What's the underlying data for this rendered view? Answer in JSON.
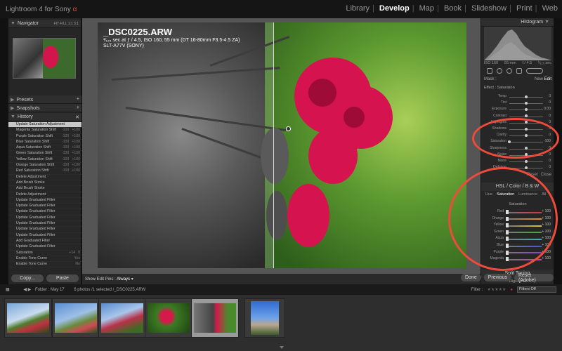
{
  "app": {
    "title": "Lightroom 4 for Sony",
    "brand_mark": "α"
  },
  "modules": [
    "Library",
    "Develop",
    "Map",
    "Book",
    "Slideshow",
    "Print",
    "Web"
  ],
  "active_module": "Develop",
  "left_panel": {
    "navigator": {
      "title": "Navigator",
      "zoom_options": [
        "FIT",
        "FILL",
        "1:1",
        "3:1"
      ]
    },
    "presets": {
      "title": "Presets"
    },
    "snapshots": {
      "title": "Snapshots"
    },
    "history": {
      "title": "History",
      "items": [
        {
          "label": "Update Saturation Adjustment",
          "v1": "",
          "v2": ""
        },
        {
          "label": "Magenta Saturation Shift",
          "v1": "-100",
          "v2": "+100"
        },
        {
          "label": "Purple Saturation Shift",
          "v1": "-100",
          "v2": "+100"
        },
        {
          "label": "Blue Saturation Shift",
          "v1": "-100",
          "v2": "+100"
        },
        {
          "label": "Aqua Saturation Shift",
          "v1": "-100",
          "v2": "+100"
        },
        {
          "label": "Green Saturation Shift",
          "v1": "-100",
          "v2": "+100"
        },
        {
          "label": "Yellow Saturation Shift",
          "v1": "-100",
          "v2": "+100"
        },
        {
          "label": "Orange Saturation Shift",
          "v1": "-100",
          "v2": "+100"
        },
        {
          "label": "Red Saturation Shift",
          "v1": "-100",
          "v2": "+100"
        },
        {
          "label": "Delete Adjustment",
          "v1": "",
          "v2": ""
        },
        {
          "label": "Add Brush Stroke",
          "v1": "",
          "v2": ""
        },
        {
          "label": "Add Brush Stroke",
          "v1": "",
          "v2": ""
        },
        {
          "label": "Delete Adjustment",
          "v1": "",
          "v2": ""
        },
        {
          "label": "Update Graduated Filter",
          "v1": "",
          "v2": ""
        },
        {
          "label": "Update Graduated Filter",
          "v1": "",
          "v2": ""
        },
        {
          "label": "Update Graduated Filter",
          "v1": "",
          "v2": ""
        },
        {
          "label": "Update Graduated Filter",
          "v1": "",
          "v2": ""
        },
        {
          "label": "Update Graduated Filter",
          "v1": "",
          "v2": ""
        },
        {
          "label": "Update Graduated Filter",
          "v1": "",
          "v2": ""
        },
        {
          "label": "Update Graduated Filter",
          "v1": "",
          "v2": ""
        },
        {
          "label": "Add Graduated Filter",
          "v1": "",
          "v2": ""
        },
        {
          "label": "Update Graduated Filter",
          "v1": "",
          "v2": ""
        },
        {
          "label": "Saturation",
          "v1": "+14",
          "v2": "0"
        },
        {
          "label": "Enable Tone Curve",
          "v1": "",
          "v2": "Yes"
        },
        {
          "label": "Enable Tone Curve",
          "v1": "",
          "v2": "No"
        }
      ]
    },
    "buttons": {
      "copy": "Copy...",
      "paste": "Paste"
    }
  },
  "photo": {
    "filename": "_DSC0225.ARW",
    "exposure": "¹⁄₁₂₅ sec at ƒ / 4.5, ISO 160, 55 mm (DT 16-80mm F3.5-4.5 ZA)",
    "camera": "SLT-A77V (SONY)"
  },
  "toolbar": {
    "show_edit_pins_label": "Show Edit Pins :",
    "show_edit_pins_value": "Always"
  },
  "right_panel": {
    "histogram": {
      "title": "Histogram",
      "readout": [
        "ISO 160",
        "55 mm",
        "f / 4.5",
        "¹⁄₁₂₅ sec"
      ]
    },
    "mask": {
      "label": "Mask :",
      "new": "New",
      "edit": "Edit"
    },
    "effect": {
      "label": "Effect :",
      "value": "Saturation"
    },
    "brush_sliders": [
      {
        "label": "Temp",
        "pos": 0.5,
        "value": "0"
      },
      {
        "label": "Tint",
        "pos": 0.5,
        "value": "0"
      },
      {
        "label": "Exposure",
        "pos": 0.5,
        "value": "0.00"
      },
      {
        "label": "Contrast",
        "pos": 0.5,
        "value": "0"
      },
      {
        "label": "Highlights",
        "pos": 0.5,
        "value": "0"
      },
      {
        "label": "Shadows",
        "pos": 0.5,
        "value": "0"
      },
      {
        "label": "Clarity",
        "pos": 0.5,
        "value": "0"
      },
      {
        "label": "Saturation",
        "pos": 0.0,
        "value": "-100"
      },
      {
        "label": "Sharpness",
        "pos": 0.5,
        "value": "0"
      },
      {
        "label": "Noise",
        "pos": 0.5,
        "value": "0"
      },
      {
        "label": "Moiré",
        "pos": 0.5,
        "value": "0"
      },
      {
        "label": "Defringe",
        "pos": 0.5,
        "value": "0"
      }
    ],
    "reset_close": {
      "reset": "Reset",
      "close": "Close"
    },
    "hsl": {
      "header": "HSL / Color / B & W",
      "tabs": [
        "Hue",
        "Saturation",
        "Luminance",
        "All"
      ],
      "active_tab": "Saturation",
      "section_label": "Saturation",
      "channels": [
        {
          "label": "Red",
          "value": "+ 100",
          "color": "#d33"
        },
        {
          "label": "Orange",
          "value": "+ 100",
          "color": "#e98a2b"
        },
        {
          "label": "Yellow",
          "value": "+ 100",
          "color": "#d8c62f"
        },
        {
          "label": "Green",
          "value": "+ 100",
          "color": "#4aa63a"
        },
        {
          "label": "Aqua",
          "value": "+ 100",
          "color": "#39b1b5"
        },
        {
          "label": "Blue",
          "value": "+ 100",
          "color": "#3a5fd0"
        },
        {
          "label": "Purple",
          "value": "+ 100",
          "color": "#8b44c4"
        },
        {
          "label": "Magenta",
          "value": "+ 100",
          "color": "#d040a4"
        }
      ]
    },
    "split_toning": {
      "title": "Split Toning",
      "highlights": "Highlights"
    },
    "buttons": {
      "done": "Done",
      "previous": "Previous",
      "reset": "Reset (Adobe)"
    }
  },
  "filmstrip_bar": {
    "folder": "Folder : May 17",
    "count": "6 photos /1 selected /_DSC0225.ARW",
    "filter_label": "Filter :",
    "filter_value": "Filters Off"
  },
  "filmstrip": {
    "thumbnails": [
      "thumb-1",
      "thumb-2",
      "thumb-3",
      "thumb-4",
      "thumb-5",
      "thumb-6"
    ],
    "selected_index": 4
  }
}
